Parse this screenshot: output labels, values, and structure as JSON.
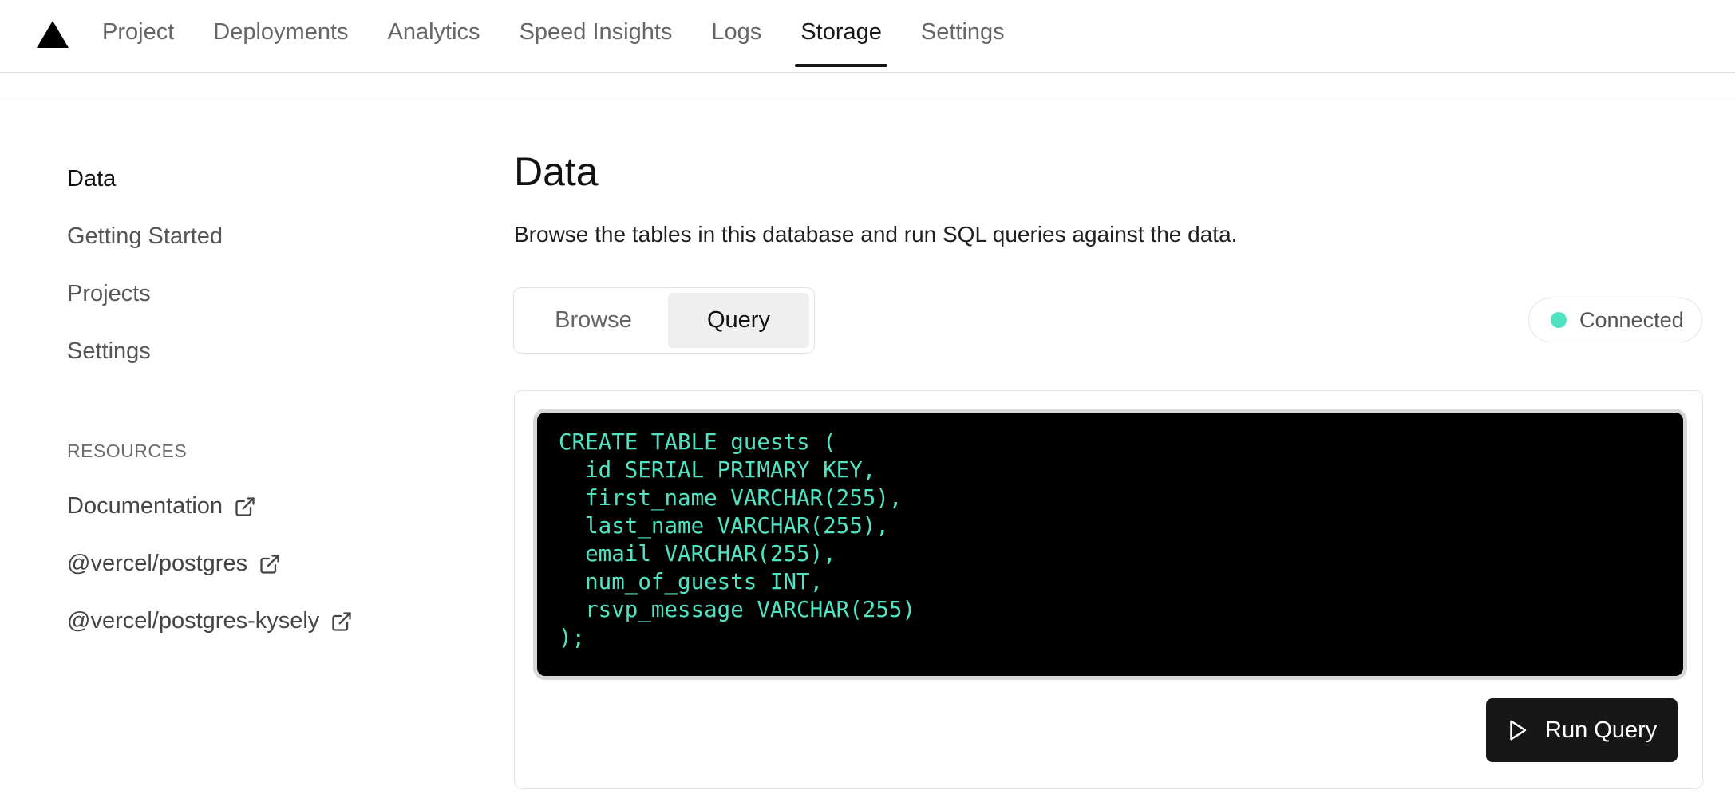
{
  "nav": {
    "logo_icon": "vercel-triangle-icon",
    "tabs": [
      {
        "label": "Project"
      },
      {
        "label": "Deployments"
      },
      {
        "label": "Analytics"
      },
      {
        "label": "Speed Insights"
      },
      {
        "label": "Logs"
      },
      {
        "label": "Storage",
        "active": true
      },
      {
        "label": "Settings"
      }
    ]
  },
  "sidebar": {
    "items": [
      {
        "label": "Data",
        "active": true
      },
      {
        "label": "Getting Started"
      },
      {
        "label": "Projects"
      },
      {
        "label": "Settings"
      }
    ],
    "resources_heading": "RESOURCES",
    "resources": [
      {
        "label": "Documentation",
        "icon": "external-link-icon"
      },
      {
        "label": "@vercel/postgres",
        "icon": "external-link-icon"
      },
      {
        "label": "@vercel/postgres-kysely",
        "icon": "external-link-icon"
      }
    ]
  },
  "main": {
    "title": "Data",
    "description": "Browse the tables in this database and run SQL queries against the data.",
    "segment": {
      "browse_label": "Browse",
      "query_label": "Query",
      "selected": "Query"
    },
    "status": {
      "label": "Connected",
      "color": "#50e3c2"
    },
    "editor": {
      "code": "CREATE TABLE guests (\n  id SERIAL PRIMARY KEY,\n  first_name VARCHAR(255),\n  last_name VARCHAR(255),\n  email VARCHAR(255),\n  num_of_guests INT,\n  rsvp_message VARCHAR(255)\n);",
      "text_color": "#50e3c2"
    },
    "run_button": {
      "label": "Run Query",
      "icon": "play-icon"
    }
  }
}
